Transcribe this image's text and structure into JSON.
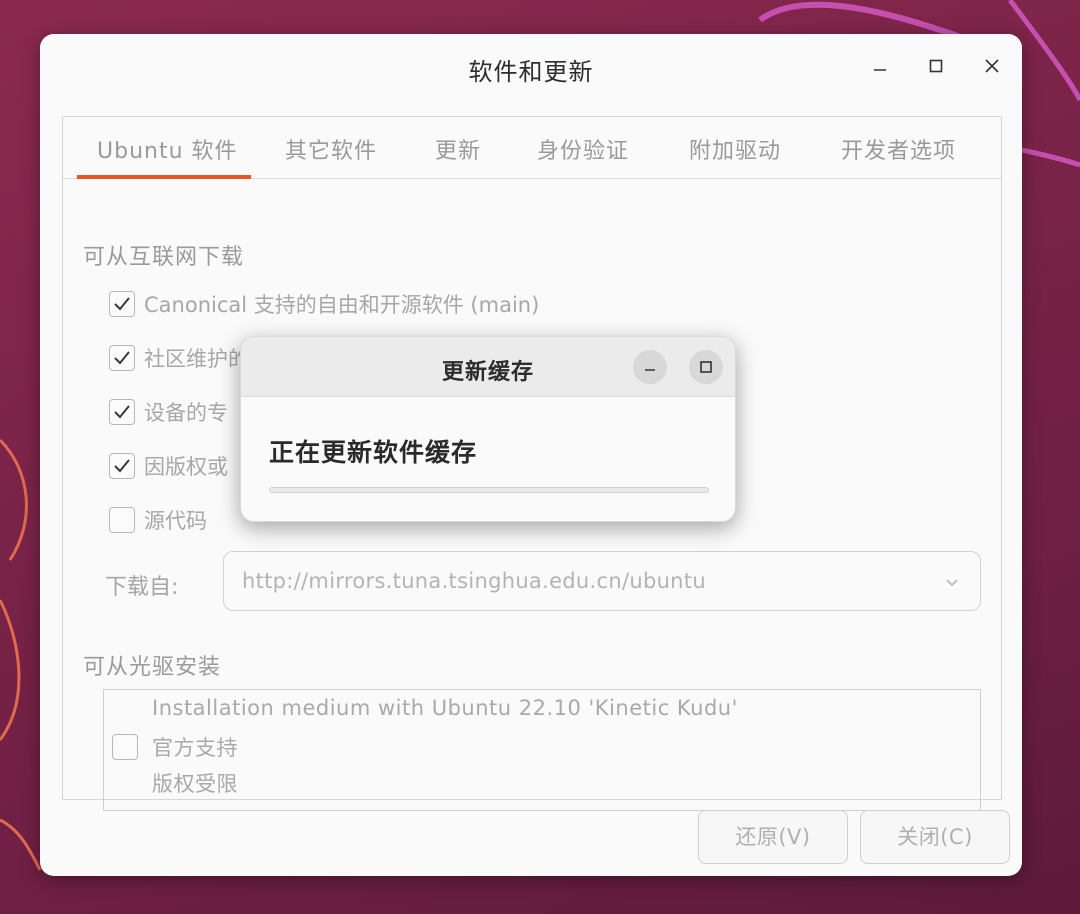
{
  "window": {
    "title": "软件和更新"
  },
  "tabs": [
    {
      "label": "Ubuntu 软件",
      "active": true
    },
    {
      "label": "其它软件",
      "active": false
    },
    {
      "label": "更新",
      "active": false
    },
    {
      "label": "身份验证",
      "active": false
    },
    {
      "label": "附加驱动",
      "active": false
    },
    {
      "label": "开发者选项",
      "active": false
    }
  ],
  "internet": {
    "heading": "可从互联网下载",
    "items": [
      {
        "label": "Canonical 支持的自由和开源软件 (main)",
        "checked": true
      },
      {
        "label": "社区维护的自由和开源软件 (universe)",
        "checked": true
      },
      {
        "label": "设备的专",
        "checked": true
      },
      {
        "label": "因版权或",
        "checked": true
      },
      {
        "label": "源代码",
        "checked": false
      }
    ],
    "download_from_label": "下载自:",
    "mirror": "http://mirrors.tuna.tsinghua.edu.cn/ubuntu"
  },
  "cdrom": {
    "heading": "可从光驱安装",
    "checked": false,
    "lines": [
      "Installation medium with Ubuntu 22.10 'Kinetic Kudu'",
      "官方支持",
      "版权受限"
    ]
  },
  "buttons": {
    "revert": "还原(V)",
    "close": "关闭(C)"
  },
  "dialog": {
    "title": "更新缓存",
    "message": "正在更新软件缓存",
    "progress": 0
  },
  "colors": {
    "accent": "#e95420",
    "wallpaper": "#7a2348"
  }
}
